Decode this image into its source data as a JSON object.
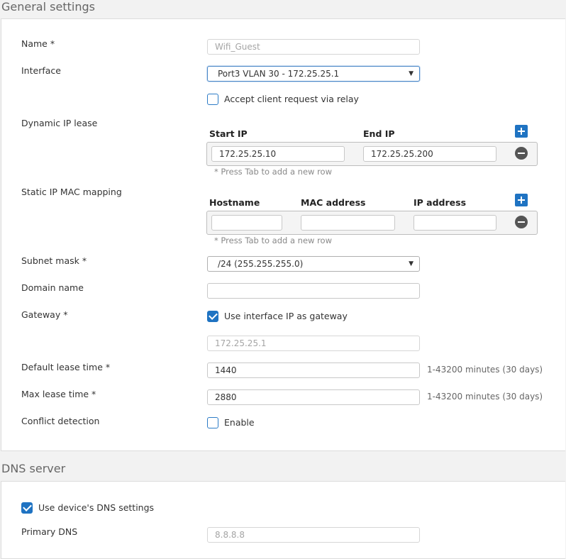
{
  "general": {
    "title": "General settings",
    "name_label": "Name *",
    "name_value": "Wifi_Guest",
    "interface_label": "Interface",
    "interface_value": "Port3 VLAN 30 - 172.25.25.1",
    "relay_label": "Accept client request via relay",
    "relay_checked": false,
    "dynamic_label": "Dynamic IP lease",
    "dynamic": {
      "start_header": "Start IP",
      "end_header": "End IP",
      "start_value": "172.25.25.10",
      "end_value": "172.25.25.200",
      "hint": "* Press Tab to add a new row"
    },
    "static_label": "Static IP MAC mapping",
    "static": {
      "hostname_header": "Hostname",
      "mac_header": "MAC address",
      "ip_header": "IP address",
      "hostname_value": "",
      "mac_value": "",
      "ip_value": "",
      "hint": "* Press Tab to add a new row"
    },
    "subnet_label": "Subnet mask *",
    "subnet_value": "/24 (255.255.255.0)",
    "domain_label": "Domain name",
    "domain_value": "",
    "gateway_label": "Gateway *",
    "gateway_checkbox_label": "Use interface IP as gateway",
    "gateway_checked": true,
    "gateway_value": "172.25.25.1",
    "default_lease_label": "Default lease time *",
    "default_lease_value": "1440",
    "default_lease_note": "1-43200 minutes (30 days)",
    "max_lease_label": "Max lease time *",
    "max_lease_value": "2880",
    "max_lease_note": "1-43200 minutes (30 days)",
    "conflict_label": "Conflict detection",
    "conflict_checkbox_label": "Enable",
    "conflict_checked": false
  },
  "dns": {
    "title": "DNS server",
    "use_device_label": "Use device's DNS settings",
    "use_device_checked": true,
    "primary_label": "Primary DNS",
    "primary_value": "8.8.8.8"
  },
  "colors": {
    "accent": "#1f73c2",
    "panel_bg": "#ffffff",
    "page_bg": "#f2f2f2"
  }
}
